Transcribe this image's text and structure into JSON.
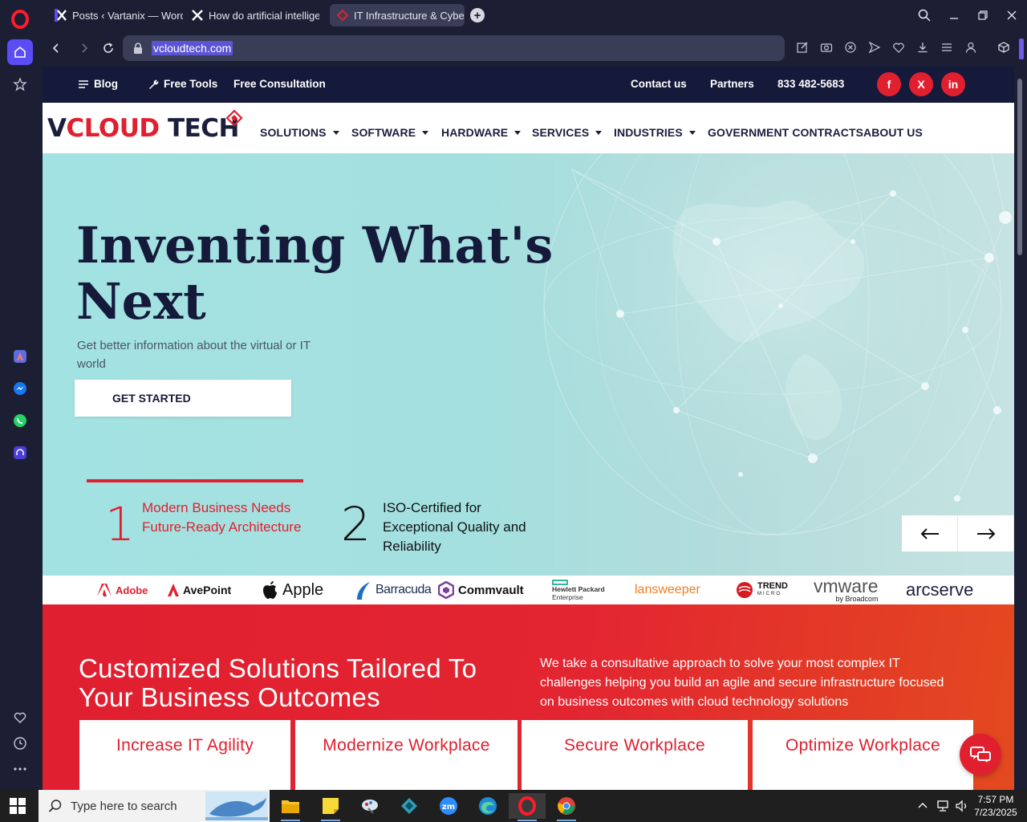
{
  "browser": {
    "tabs": [
      {
        "label": "Posts ‹ Vartanix — WordPress",
        "active": false
      },
      {
        "label": "How do artificial intelligence",
        "active": false
      },
      {
        "label": "IT Infrastructure & Cybersecurity",
        "active": true
      }
    ],
    "url": "vcloudtech.com"
  },
  "site": {
    "topbar": {
      "blog": "Blog",
      "free_tools": "Free Tools",
      "free_consultation": "Free Consultation",
      "contact": "Contact us",
      "partners": "Partners",
      "phone": "833 482-5683",
      "social": {
        "facebook": "f",
        "x": "X",
        "linkedin": "in"
      }
    },
    "logo": {
      "v": "V",
      "cloud": "CLOUD",
      "tech": " TECH"
    },
    "nav": {
      "solutions": "SOLUTIONS",
      "software": "SOFTWARE",
      "hardware": "HARDWARE",
      "services": "SERVICES",
      "industries": "INDUSTRIES",
      "government": "GOVERNMENT CONTRACTS",
      "about": "ABOUT US"
    },
    "hero": {
      "title": "Inventing What's Next",
      "subtitle": "Get better information about the virtual or IT world",
      "cta": "GET STARTED",
      "slides": [
        {
          "num": "1",
          "text": "Modern Business Needs Future-Ready Architecture"
        },
        {
          "num": "2",
          "text": "ISO-Certified for Exceptional Quality and Reliability"
        }
      ]
    },
    "brands": {
      "adobe": "Adobe",
      "avepoint": "AvePoint",
      "apple": "Apple",
      "barracuda": "Barracuda",
      "commvault": "Commvault",
      "hpe_1": "Hewlett Packard",
      "hpe_2": "Enterprise",
      "lansweeper": "lansweeper",
      "trend_1": "TREND",
      "trend_2": "MICRO",
      "vmware": "vmware",
      "vmware_by": "by Broadcom",
      "arcserve": "arcserve"
    },
    "solutions": {
      "heading": "Customized Solutions Tailored To Your Business Outcomes",
      "body": "We take a consultative approach to solve your most complex IT challenges helping you build an agile and secure infrastructure focused on business outcomes with cloud technology solutions",
      "cards": [
        "Increase IT Agility",
        "Modernize Workplace",
        "Secure Workplace",
        "Optimize Workplace"
      ]
    }
  },
  "taskbar": {
    "search_placeholder": "Type here to search",
    "time": "7:57 PM",
    "date": "7/23/2025"
  },
  "colors": {
    "brand_red": "#e0202f",
    "navy": "#15193a",
    "opera_bg": "#1c1e33",
    "hero_teal": "#a3e2e2"
  }
}
